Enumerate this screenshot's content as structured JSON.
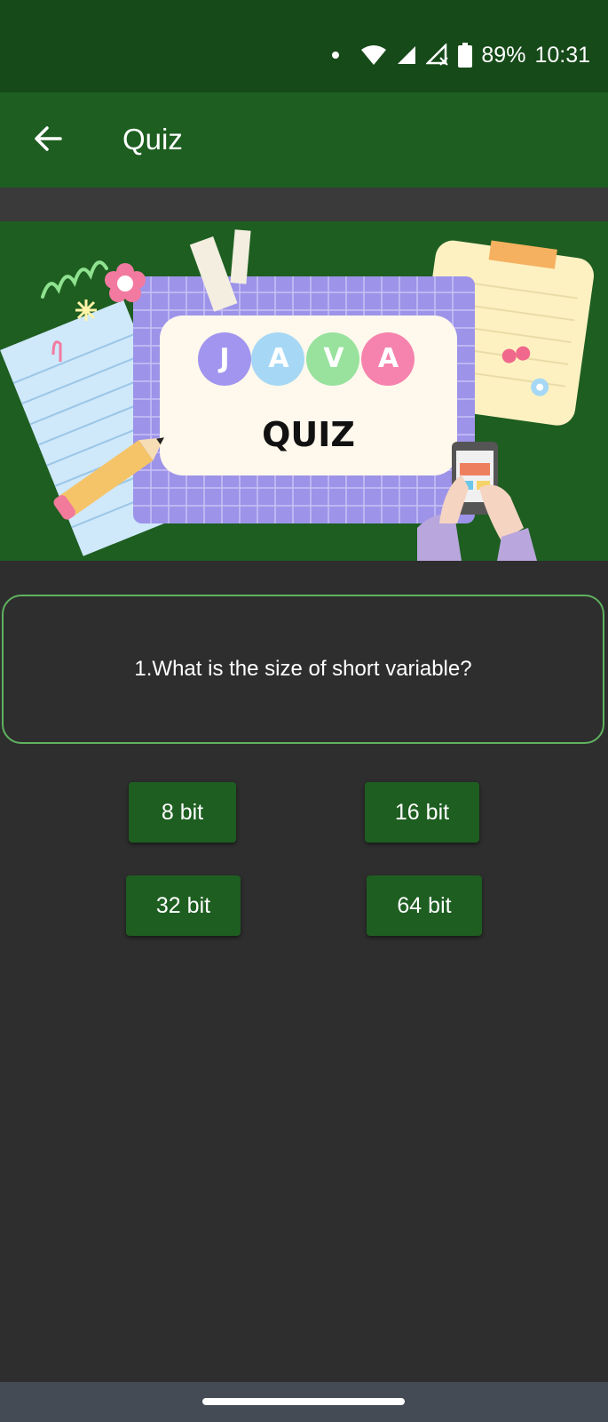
{
  "status_bar": {
    "battery": "89%",
    "time": "10:31"
  },
  "app_bar": {
    "title": "Quiz"
  },
  "banner": {
    "letters": [
      "J",
      "A",
      "V",
      "A"
    ],
    "quiz_label": "QUIZ"
  },
  "question": {
    "text": "1.What is the size of short variable?"
  },
  "options": [
    "8 bit",
    "16 bit",
    "32 bit",
    "64 bit"
  ],
  "colors": {
    "status_bg": "#164a19",
    "app_bar_bg": "#1e5e21",
    "page_bg": "#2e2e2e",
    "card_border": "#5fb25f",
    "nav_bg": "#444b54"
  }
}
